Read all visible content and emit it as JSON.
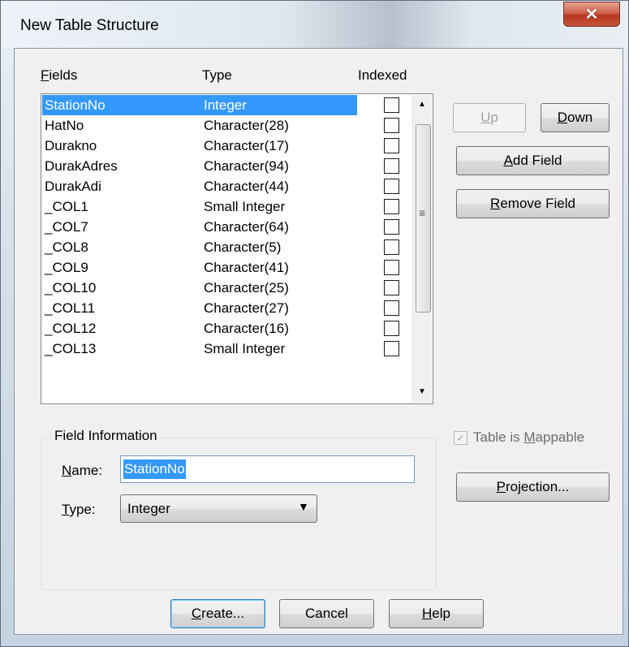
{
  "window": {
    "title": "New Table Structure",
    "close_glyph": "✕"
  },
  "list_headers": {
    "fields": "Fields",
    "type": "Type",
    "indexed": "Indexed"
  },
  "fields": [
    {
      "name": "StationNo",
      "type": "Integer",
      "indexed": false,
      "selected": true
    },
    {
      "name": "HatNo",
      "type": "Character(28)",
      "indexed": false
    },
    {
      "name": "Durakno",
      "type": "Character(17)",
      "indexed": false
    },
    {
      "name": "DurakAdres",
      "type": "Character(94)",
      "indexed": false
    },
    {
      "name": "DurakAdi",
      "type": "Character(44)",
      "indexed": false
    },
    {
      "name": "_COL1",
      "type": "Small Integer",
      "indexed": false
    },
    {
      "name": "_COL7",
      "type": "Character(64)",
      "indexed": false
    },
    {
      "name": "_COL8",
      "type": "Character(5)",
      "indexed": false
    },
    {
      "name": "_COL9",
      "type": "Character(41)",
      "indexed": false
    },
    {
      "name": "_COL10",
      "type": "Character(25)",
      "indexed": false
    },
    {
      "name": "_COL11",
      "type": "Character(27)",
      "indexed": false
    },
    {
      "name": "_COL12",
      "type": "Character(16)",
      "indexed": false
    },
    {
      "name": "_COL13",
      "type": "Small Integer",
      "indexed": false
    }
  ],
  "buttons": {
    "up": "Up",
    "down": "Down",
    "add_field": "Add Field",
    "remove_field": "Remove Field",
    "projection": "Projection...",
    "create": "Create...",
    "cancel": "Cancel",
    "help": "Help"
  },
  "field_info": {
    "legend": "Field Information",
    "name_label": "Name:",
    "name_value": "StationNo",
    "type_label": "Type:",
    "type_value": "Integer"
  },
  "mappable": {
    "label": "Table is Mappable",
    "checked": true,
    "enabled": false
  },
  "icons": {
    "scroll_up": "▲",
    "scroll_down": "▼",
    "scroll_grip": "≡",
    "combo_arrow": "▼",
    "check": "✓"
  }
}
